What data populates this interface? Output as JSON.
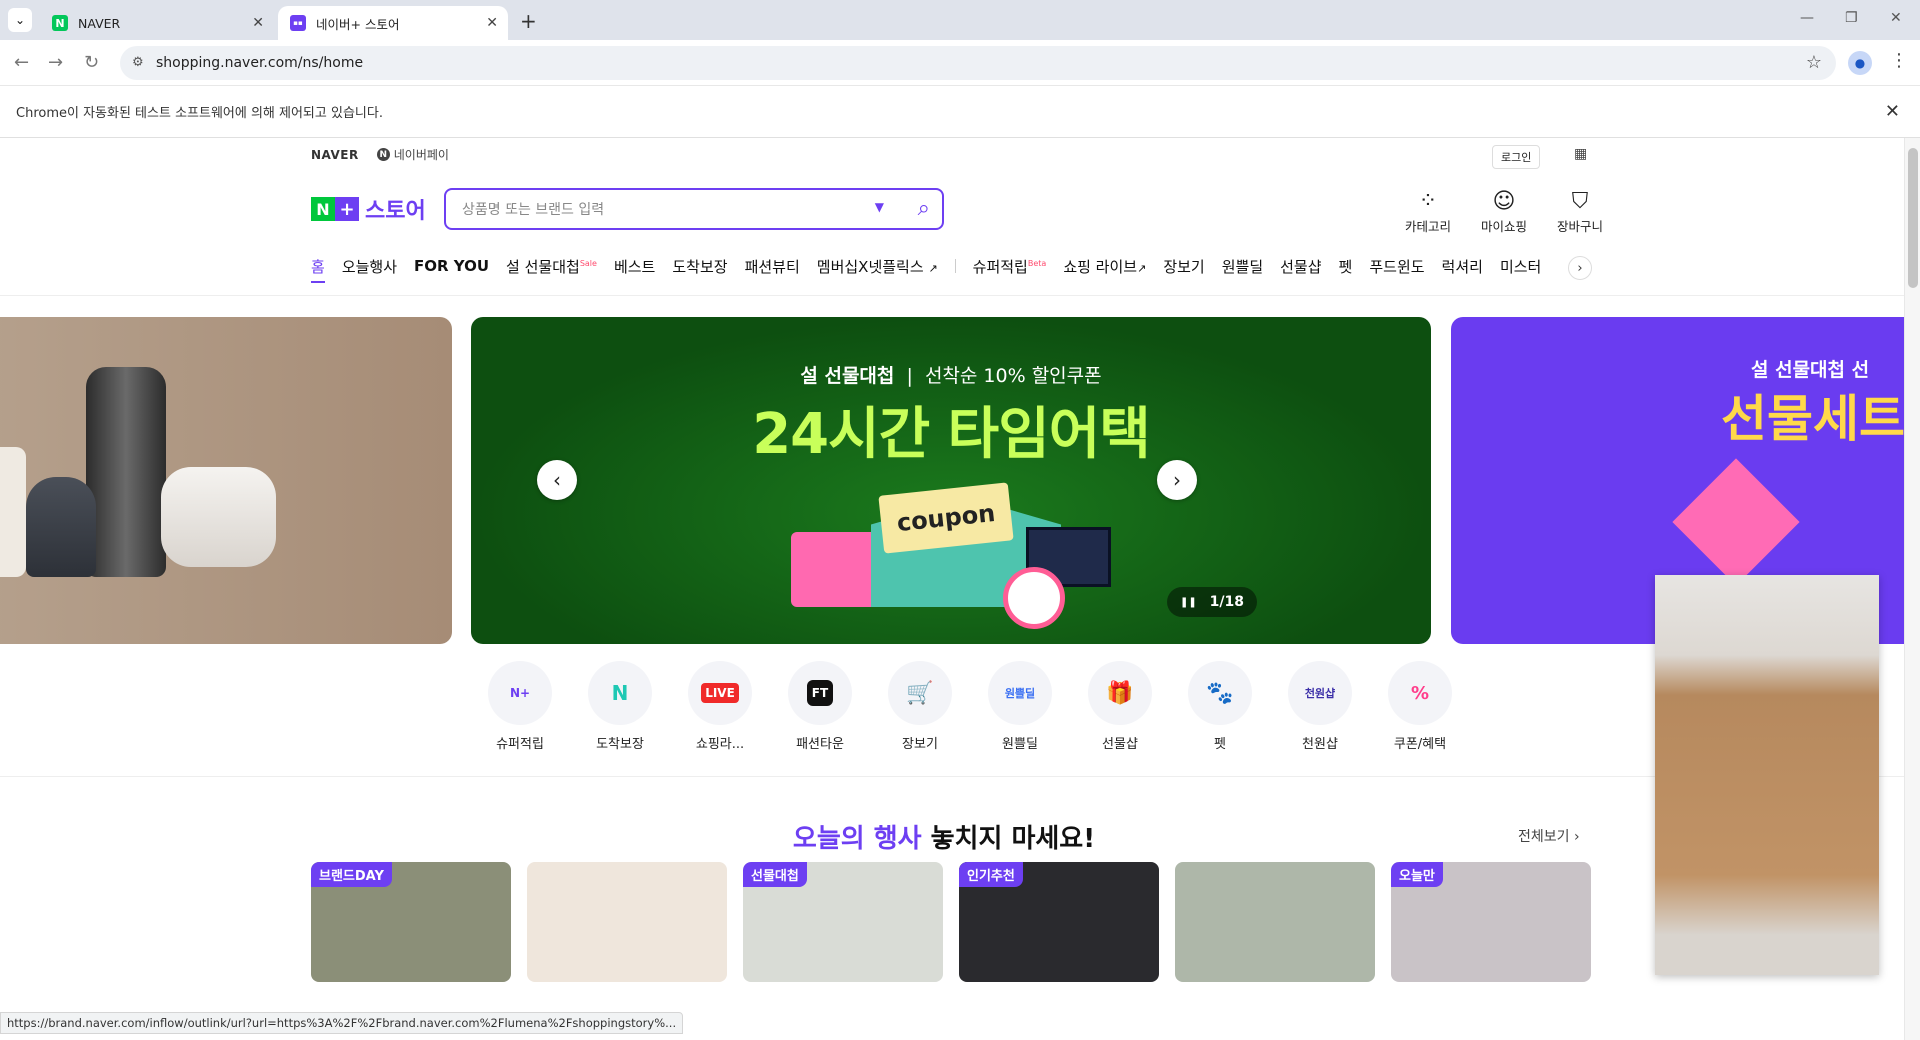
{
  "browser": {
    "tabs": [
      {
        "title": "NAVER",
        "favicon_color": "#03c75a",
        "favicon_letter": "N"
      },
      {
        "title": "네이버+ 스토어",
        "favicon_color": "#6d3ff2",
        "favicon_letter": "▪▪"
      }
    ],
    "url": "shopping.naver.com/ns/home",
    "infobar": "Chrome이 자동화된 테스트 소프트웨어에 의해 제어되고 있습니다."
  },
  "header": {
    "naver": "NAVER",
    "npay": "네이버페이",
    "login": "로그인",
    "logo_n": "N",
    "logo_plus": "+",
    "logo_store": "스토어",
    "search_placeholder": "상품명 또는 브랜드 입력",
    "quick": [
      {
        "label": "카테고리",
        "icon": "category-icon"
      },
      {
        "label": "마이쇼핑",
        "icon": "person-icon"
      },
      {
        "label": "장바구니",
        "icon": "cart-icon"
      }
    ]
  },
  "gnb": [
    "홈",
    "오늘행사",
    "FOR YOU",
    "설 선물대첩",
    "베스트",
    "도착보장",
    "패션뷰티",
    "멤버십X넷플릭스",
    "슈퍼적립",
    "쇼핑 라이브",
    "장보기",
    "원쁠딜",
    "선물샵",
    "펫",
    "푸드윈도",
    "럭셔리",
    "미스터"
  ],
  "gnb_marks": {
    "sale": "Sale",
    "beta": "Beta"
  },
  "banner": {
    "kicker_bold": "설 선물대첩",
    "kicker_rest": "선착순 10% 할인쿠폰",
    "title": "24시간 타임어택",
    "coupon": "coupon",
    "counter": "1/18",
    "pause": "❚❚",
    "right_kicker": "설 선물대첩  선",
    "right_title": "선물세트"
  },
  "categories": [
    "슈퍼적립",
    "도착보장",
    "쇼핑라...",
    "패션타운",
    "장보기",
    "원쁠딜",
    "선물샵",
    "펫",
    "천원샵",
    "쿠폰/혜택"
  ],
  "category_badges": [
    "N+",
    "N",
    "LIVE",
    "FT",
    "🛒",
    "원쁠딜",
    "🎁",
    "🐾",
    "천원샵",
    "%"
  ],
  "section": {
    "title_highlight": "오늘의 행사",
    "title_rest": " 놓치지 마세요!",
    "see_all": "전체보기 ›"
  },
  "cards": [
    {
      "badge": "브랜드DAY",
      "bg": "#8b8f78"
    },
    {
      "badge": "",
      "bg": "#efe6dc"
    },
    {
      "badge": "선물대첩",
      "bg": "#d9dcd6"
    },
    {
      "badge": "인기추천",
      "bg": "#2a2a2e"
    },
    {
      "badge": "",
      "bg": "#aeb7a9"
    },
    {
      "badge": "오늘만",
      "bg": "#c9c3c7"
    }
  ],
  "status_url": "https://brand.naver.com/inflow/outlink/url?url=https%3A%2F%2Fbrand.naver.com%2Flumena%2Fshoppingstory%..."
}
